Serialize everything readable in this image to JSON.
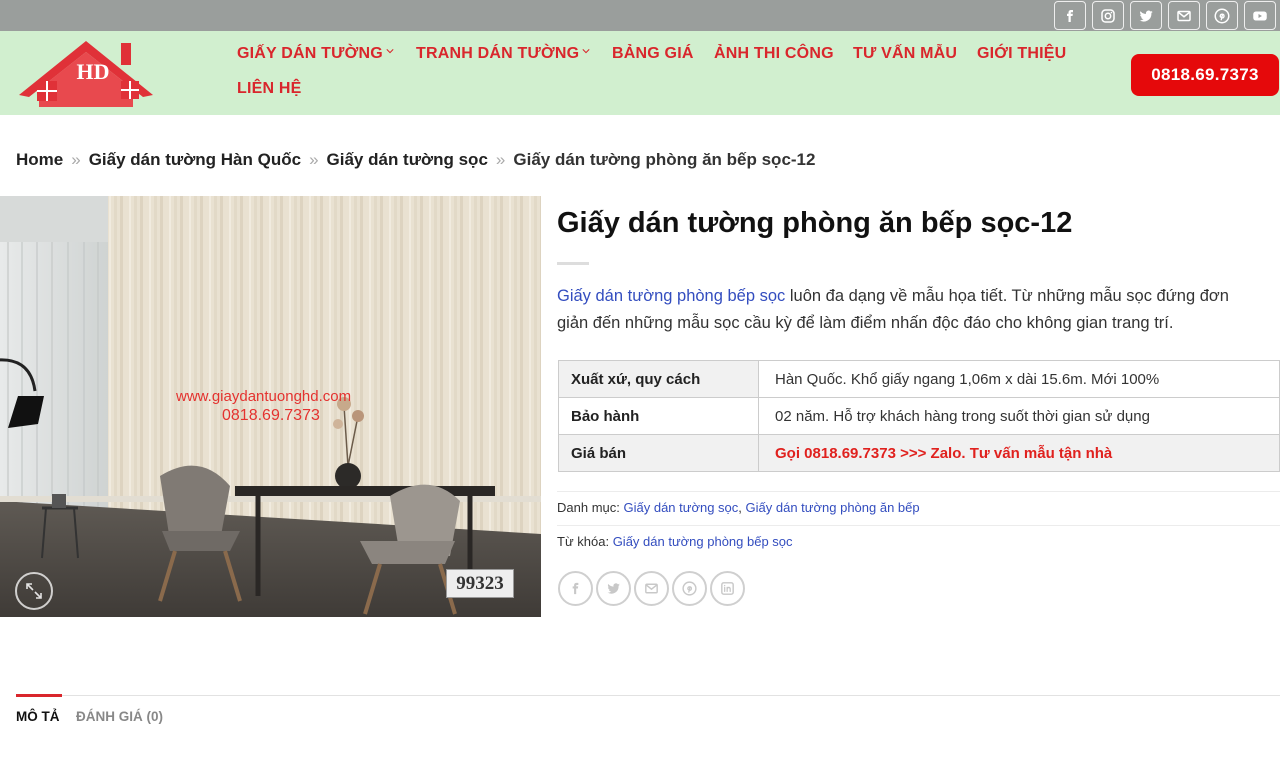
{
  "social_top": [
    "facebook-icon",
    "instagram-icon",
    "twitter-icon",
    "email-icon",
    "pinterest-icon",
    "youtube-icon"
  ],
  "logo": {
    "text": "HD"
  },
  "nav": {
    "items": [
      {
        "label": "GIẤY DÁN TƯỜNG",
        "has_dropdown": true
      },
      {
        "label": "TRANH DÁN TƯỜNG",
        "has_dropdown": true
      },
      {
        "label": "BẢNG GIÁ",
        "has_dropdown": false
      },
      {
        "label": "ẢNH THI CÔNG",
        "has_dropdown": false
      },
      {
        "label": "TƯ VẤN MẪU",
        "has_dropdown": false
      },
      {
        "label": "GIỚI THIỆU",
        "has_dropdown": false
      },
      {
        "label": "LIÊN HỆ",
        "has_dropdown": false
      }
    ],
    "phone": "0818.69.7373"
  },
  "breadcrumb": {
    "items": [
      "Home",
      "Giấy dán tường Hàn Quốc",
      "Giấy dán tường sọc"
    ],
    "current": "Giấy dán tường phòng ăn bếp sọc-12",
    "separator": "»"
  },
  "image": {
    "watermark_url": "www.giaydantuonghd.com",
    "watermark_phone": "0818.69.7373",
    "code": "99323"
  },
  "product": {
    "title": "Giấy dán tường phòng ăn bếp sọc-12",
    "desc_link": "Giấy dán tường phòng bếp sọc",
    "desc_line1": " luôn đa dạng về mẫu họa tiết. Từ những mẫu sọc đứng đơn",
    "desc_line2": "giản đến những mẫu sọc cầu kỳ để làm điểm nhấn độc đáo cho không gian trang trí.",
    "specs": [
      {
        "label": "Xuất xứ, quy cách",
        "value": "Hàn Quốc. Khổ giấy ngang 1,06m x dài 15.6m. Mới 100%"
      },
      {
        "label": "Bảo hành",
        "value": "02 năm. Hỗ trợ khách hàng trong suốt thời gian sử dụng"
      },
      {
        "label": "Giá bán",
        "value": "Gọi 0818.69.7373 >>> Zalo. Tư vấn mẫu tận nhà"
      }
    ],
    "category_label": "Danh mục:",
    "categories": [
      "Giấy dán tường sọc",
      "Giấy dán tường phòng ăn bếp"
    ],
    "category_sep": ", ",
    "tag_label": "Từ khóa:",
    "tag": "Giấy dán tường phòng bếp sọc"
  },
  "share": [
    "facebook-icon",
    "twitter-icon",
    "email-icon",
    "pinterest-icon",
    "linkedin-icon"
  ],
  "tabs": {
    "description": "MÔ TẢ",
    "reviews": "ĐÁNH GIÁ (0)"
  },
  "colors": {
    "accent": "#d9262c",
    "header_bg": "#d1efcf",
    "topbar_bg": "#9a9e9c",
    "phone_button": "#e5090b",
    "link": "#334dbf"
  }
}
